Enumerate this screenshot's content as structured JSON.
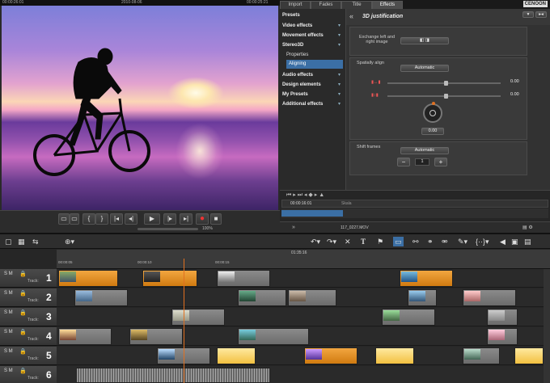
{
  "preview": {
    "timecode_left": "00:00:26:01",
    "date": "2010-08-06",
    "timecode_right": "00:00:25:21",
    "zoom": "100%"
  },
  "tabs": [
    "Import",
    "Fades",
    "Title",
    "Effects"
  ],
  "brand": "CENOON",
  "effects_list": [
    {
      "label": "Presets",
      "arrow": "▸"
    },
    {
      "label": "Video effects",
      "arrow": "▾"
    },
    {
      "label": "Movement effects",
      "arrow": "▾"
    },
    {
      "label": "Stereo3D",
      "arrow": "▾"
    },
    {
      "label": "Properties",
      "arrow": ""
    },
    {
      "label": "Aligning",
      "arrow": ""
    },
    {
      "label": "Audio effects",
      "arrow": "▾"
    },
    {
      "label": "Design elements",
      "arrow": "▾"
    },
    {
      "label": "My Presets",
      "arrow": "▾"
    },
    {
      "label": "Additional effects",
      "arrow": "▾"
    }
  ],
  "fx_panel": {
    "title": "3D justification",
    "exchange_label": "Exchange left and right image",
    "spatially_align": "Spatially align",
    "auto_btn": "Automatic",
    "val1": "0.00",
    "val2": "0.00",
    "knob_val": "0.00",
    "shift_frames": "Shift frames",
    "shift_auto": "Automatic",
    "minus": "−",
    "plus": "+",
    "shift_value": "1"
  },
  "mini_timeline": {
    "timecode": "00:00:16:01",
    "filename": "117_0227.MOV",
    "scale_label": "Skala"
  },
  "arranger": {
    "ruler_time": "01:35:16",
    "ticks": [
      "00:00:05",
      "00:00:10",
      "00:00:15"
    ],
    "tracks": [
      {
        "num": "1",
        "label": "Track:"
      },
      {
        "num": "2",
        "label": "Track:"
      },
      {
        "num": "3",
        "label": "Track:"
      },
      {
        "num": "4",
        "label": "Track:"
      },
      {
        "num": "5",
        "label": "Track:"
      },
      {
        "num": "6",
        "label": "Track:"
      }
    ],
    "sm": "S M"
  },
  "colors": {
    "accent": "#e07020",
    "selected": "#3b6fa5"
  }
}
